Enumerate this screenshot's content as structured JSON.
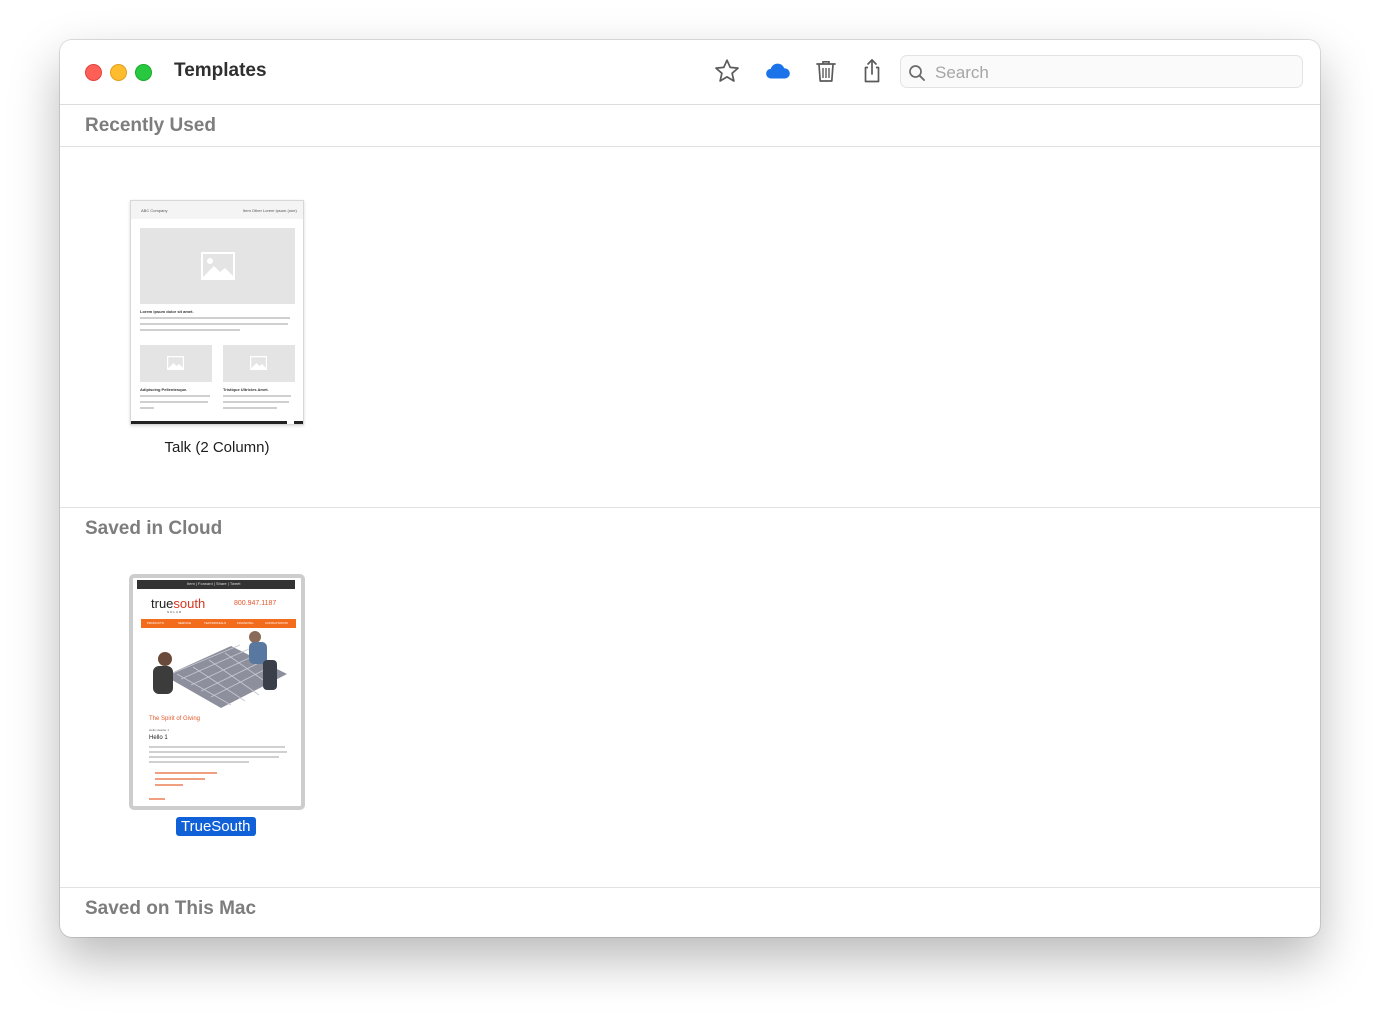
{
  "window": {
    "title": "Templates"
  },
  "toolbar": {
    "icons": [
      "star-icon",
      "cloud-icon",
      "trash-icon",
      "share-icon"
    ],
    "accent_cloud": "#1a73e8"
  },
  "search": {
    "placeholder": "Search",
    "value": ""
  },
  "sections": {
    "recent": {
      "title": "Recently Used",
      "items": [
        {
          "name": "Talk (2 Column)",
          "preview": {
            "company": "ABC Company",
            "nav": "Item Other   Lorem Ipsum (one)",
            "heading": "Lorem ipsum dolor sit amet.",
            "col1_heading": "Adipiscing Pellentesque.",
            "col2_heading": "Tristique Ultricies Amet."
          }
        }
      ]
    },
    "cloud": {
      "title": "Saved in Cloud",
      "items": [
        {
          "name": "TrueSouth",
          "selected": true,
          "preview": {
            "nav": "Item | Forward | Share | Tweet",
            "brand_a": "true",
            "brand_b": "south",
            "brand_sub": "SOLAR",
            "phone": "800.947.1187",
            "menu": [
              "PRODUCTS",
              "SERVICE",
              "TESTIMONIALS",
              "FINANCING",
              "CONSULTATION"
            ],
            "headline": "The Spirit of Giving",
            "greeting": "Hello Header 1",
            "subhead": "Hello 1"
          }
        }
      ]
    },
    "mac": {
      "title": "Saved on This Mac"
    }
  },
  "colors": {
    "selection": "#1060d8",
    "brand_orange": "#f36b1c",
    "brand_red": "#d4361e"
  }
}
